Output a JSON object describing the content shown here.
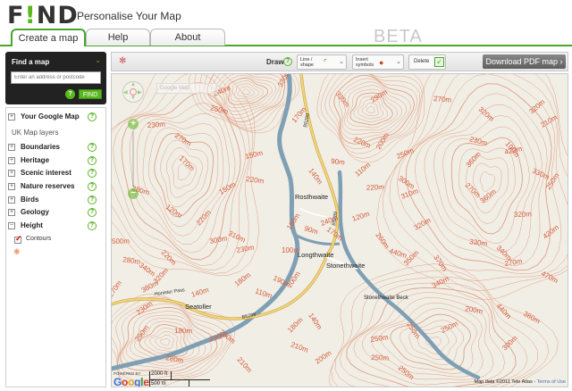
{
  "header": {
    "logo_pre": "F",
    "logo_bang": "!",
    "logo_post": "ND",
    "tagline": "Personalise Your Map",
    "beta": "BETA"
  },
  "tabs": [
    {
      "label": "Create a map",
      "active": true
    },
    {
      "label": "Help",
      "active": false
    },
    {
      "label": "About",
      "active": false
    }
  ],
  "find": {
    "title": "Find a map",
    "placeholder": "Enter an address or postcode",
    "help": "?",
    "button": "FIND"
  },
  "layers": {
    "your_map": "Your Google Map",
    "uk_title": "UK Map layers",
    "items": [
      "Boundaries",
      "Heritage",
      "Scenic interest",
      "Nature reserves",
      "Birds",
      "Geology",
      "Height"
    ],
    "contours": "Contours",
    "help": "?"
  },
  "toolbar": {
    "draw": "Draw",
    "help": "?",
    "line_shape": "Line / shape",
    "insert_symbols": "Insert symbols",
    "delete": "Delete",
    "pdf": "Download PDF map ›"
  },
  "map": {
    "map_type_control": "Google Map",
    "places": [
      "Rosthwaite",
      "Longthwaite",
      "Stonethwaite",
      "Seatoller",
      "Stonethwaite Beck"
    ],
    "passes": [
      "Honister Pass"
    ],
    "roads": [
      "B5289",
      "B5289",
      "B5289"
    ],
    "height_labels": [
      "330m",
      "240m",
      "250m",
      "330m",
      "290m",
      "270m",
      "320m",
      "320m",
      "230m",
      "270m",
      "170m",
      "150m",
      "220m",
      "200m",
      "250m",
      "230m",
      "190m",
      "210m",
      "90m",
      "170m",
      "110m",
      "220m",
      "300m",
      "360m",
      "420m",
      "330m",
      "250m",
      "310m",
      "380m",
      "140m",
      "150m",
      "220m",
      "270m",
      "360m",
      "320m",
      "120m",
      "220m",
      "300m",
      "310m",
      "160m",
      "240m",
      "90m",
      "260m",
      "320m",
      "330m",
      "340m",
      "420m",
      "500m",
      "340m",
      "320m",
      "230m",
      "190m",
      "200m",
      "120m",
      "440m",
      "370m",
      "380m",
      "280m",
      "220m",
      "180m",
      "100m",
      "170m",
      "350m",
      "270m",
      "470m",
      "270m",
      "140m",
      "110m",
      "140m",
      "340m",
      "200m",
      "440m",
      "230m",
      "180m",
      "250m",
      "180m",
      "250m",
      "380m",
      "290m",
      "230m",
      "210m",
      "250m",
      "250m",
      "280m",
      "210m",
      "200m",
      "250m",
      "250m",
      "300m"
    ],
    "powered_by": "POWERED BY",
    "google": [
      "G",
      "o",
      "o",
      "g",
      "l",
      "e"
    ],
    "scale_ft": "2000 ft",
    "scale_m": "500 m",
    "attribution": "Map data ©2011  Tele Atlas - ",
    "terms": "Terms of Use"
  },
  "colors": {
    "accent": "#5ab81f",
    "contour": "#e0a184",
    "river": "#7f9fb4",
    "road": "#f0d37a"
  }
}
